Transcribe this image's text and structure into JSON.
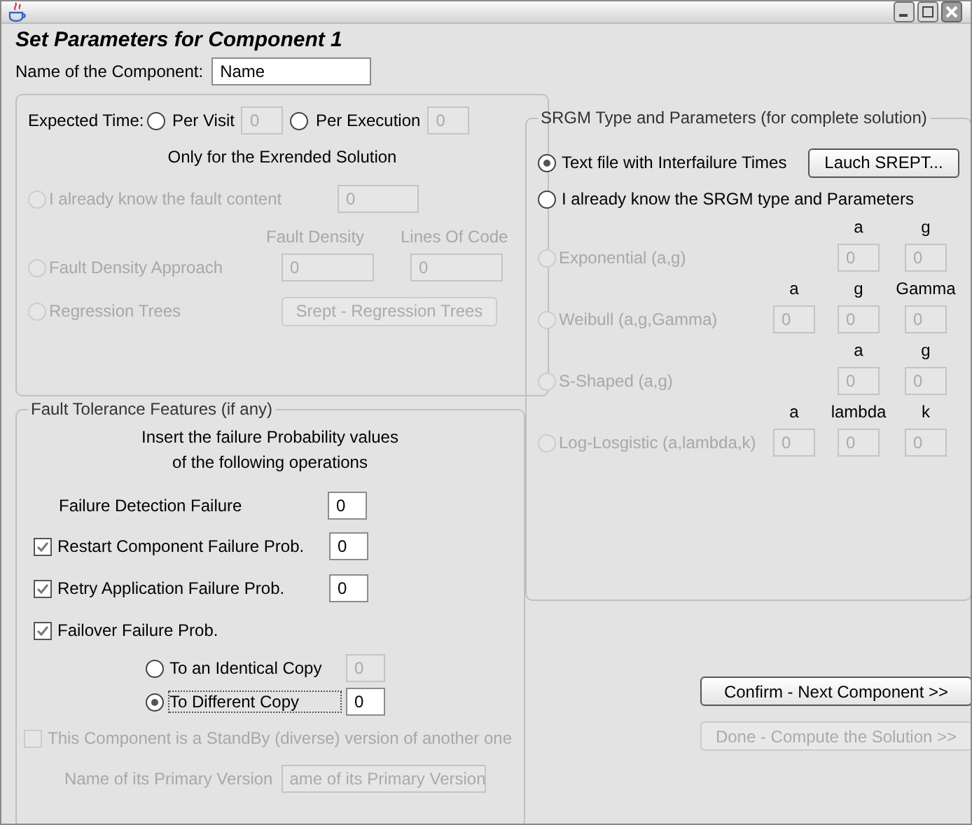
{
  "heading": "Set Parameters for Component 1",
  "name_field": {
    "label": "Name of the Component:",
    "value": "Name"
  },
  "expected_time": {
    "label": "Expected Time:",
    "options": [
      {
        "label": "Per Visit",
        "selected": false,
        "value": "0"
      },
      {
        "label": "Per Execution",
        "selected": false,
        "value": "0"
      }
    ]
  },
  "extended": {
    "note": "Only for the Exrended Solution",
    "options": [
      {
        "kind": "fields",
        "label": "I already know the fault content",
        "selected": false,
        "disabled": true,
        "fields": [
          {
            "value": "0"
          }
        ]
      },
      {
        "kind": "fields",
        "label": "Fault Density Approach",
        "selected": false,
        "disabled": true,
        "fields": [
          {
            "header": "Fault Density",
            "value": "0"
          },
          {
            "header": "Lines Of Code",
            "value": "0"
          }
        ]
      },
      {
        "kind": "button",
        "label": "Regression Trees",
        "selected": false,
        "disabled": true,
        "button": "Srept - Regression Trees"
      }
    ]
  },
  "fault_tolerance": {
    "title": "Fault Tolerance Features (if any)",
    "note_lines": [
      "Insert the failure Probability values",
      "of the following operations"
    ],
    "items": [
      {
        "kind": "plain",
        "label": "Failure Detection Failure",
        "value": "0"
      },
      {
        "kind": "check",
        "label": "Restart Component Failure Prob.",
        "checked": true,
        "value": "0"
      },
      {
        "kind": "check",
        "label": "Retry Application Failure Prob.",
        "checked": true,
        "value": "0"
      },
      {
        "kind": "check_group",
        "label": "Failover Failure Prob.",
        "checked": true,
        "children": [
          {
            "label": "To an Identical Copy",
            "selected": false,
            "value": "0"
          },
          {
            "label": "To Different Copy",
            "selected": true,
            "value": "0"
          }
        ]
      }
    ],
    "standby": {
      "label": "This Component is a StandBy (diverse) version of another one",
      "checked": false,
      "disabled": true,
      "primary_label": "Name of its Primary Version",
      "primary_value": "ame of its Primary Version"
    }
  },
  "srgm": {
    "title": "SRGM Type and Parameters (for complete solution)",
    "options": [
      {
        "label": "Text file with Interfailure Times",
        "selected": true,
        "button": "Lauch SREPT..."
      },
      {
        "label": "I already know the SRGM type and Parameters",
        "selected": false
      }
    ],
    "models": [
      {
        "label": "Exponential (a,g)",
        "selected": false,
        "disabled": true,
        "params": [
          {
            "header": "a",
            "value": "0"
          },
          {
            "header": "g",
            "value": "0"
          }
        ]
      },
      {
        "label": "Weibull (a,g,Gamma)",
        "selected": false,
        "disabled": true,
        "params": [
          {
            "header": "a",
            "value": "0"
          },
          {
            "header": "g",
            "value": "0"
          },
          {
            "header": "Gamma",
            "value": "0"
          }
        ]
      },
      {
        "label": "S-Shaped (a,g)",
        "selected": false,
        "disabled": true,
        "params": [
          {
            "header": "a",
            "value": "0"
          },
          {
            "header": "g",
            "value": "0"
          }
        ]
      },
      {
        "label": "Log-Losgistic (a,lambda,k)",
        "selected": false,
        "disabled": true,
        "params": [
          {
            "header": "a",
            "value": "0"
          },
          {
            "header": "lambda",
            "value": "0"
          },
          {
            "header": "k",
            "value": "0"
          }
        ]
      }
    ]
  },
  "buttons": [
    {
      "label": "Confirm - Next Component >>",
      "disabled": false
    },
    {
      "label": "Done - Compute the Solution >>",
      "disabled": true
    }
  ]
}
